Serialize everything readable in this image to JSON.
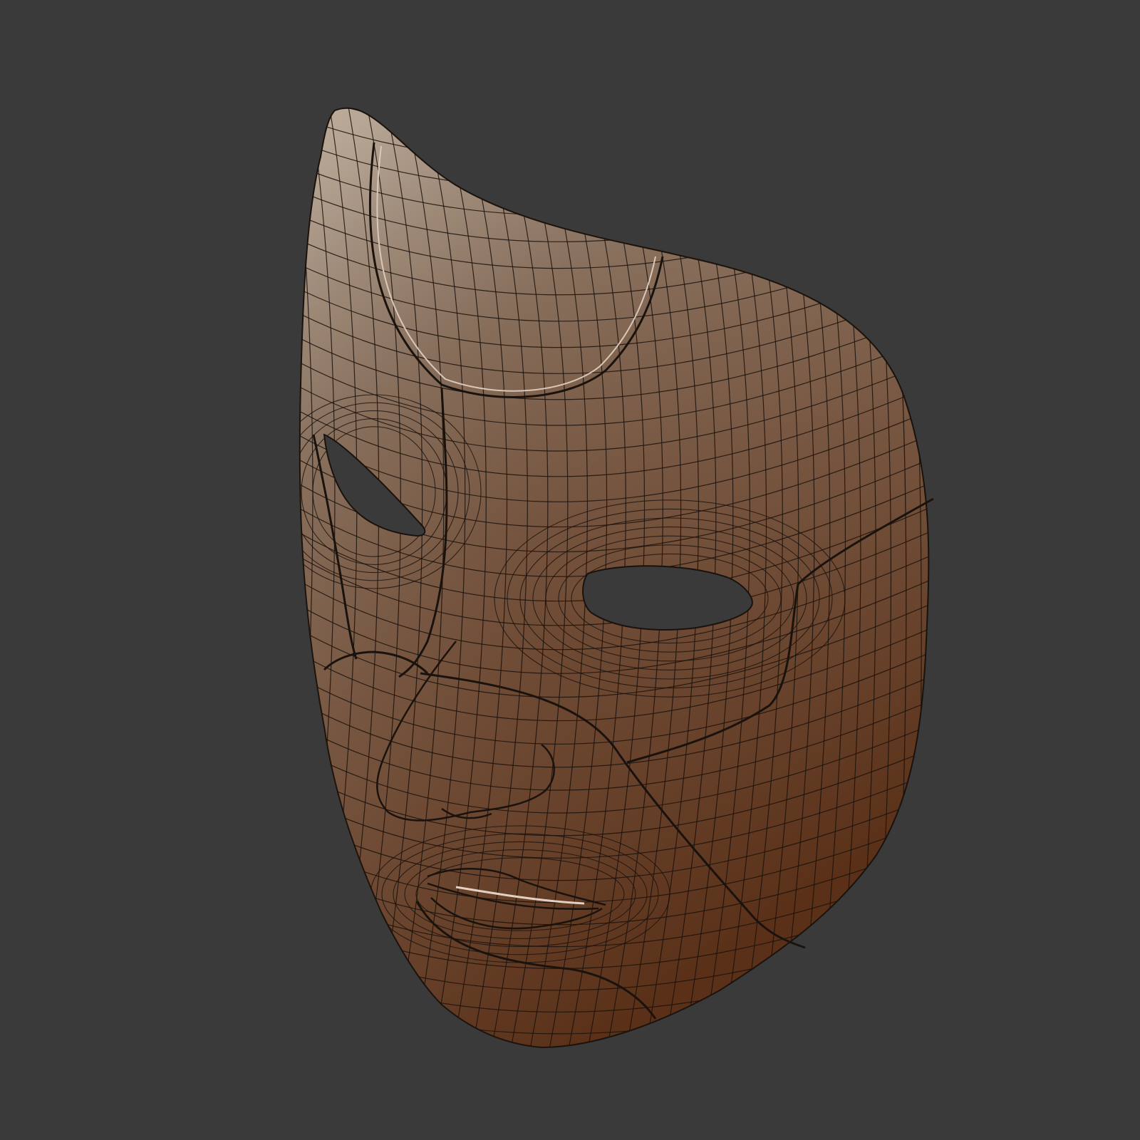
{
  "scene": {
    "subject": "face-mask-wireframe",
    "background_color": "#3a3a3a",
    "mask_base_color": "#7a5a45",
    "mask_highlight_color": "#8f7a68",
    "mask_shadow_color": "#5a3018",
    "wire_color": "#1a120c",
    "eye_hole_color": "#3a3a3a"
  }
}
